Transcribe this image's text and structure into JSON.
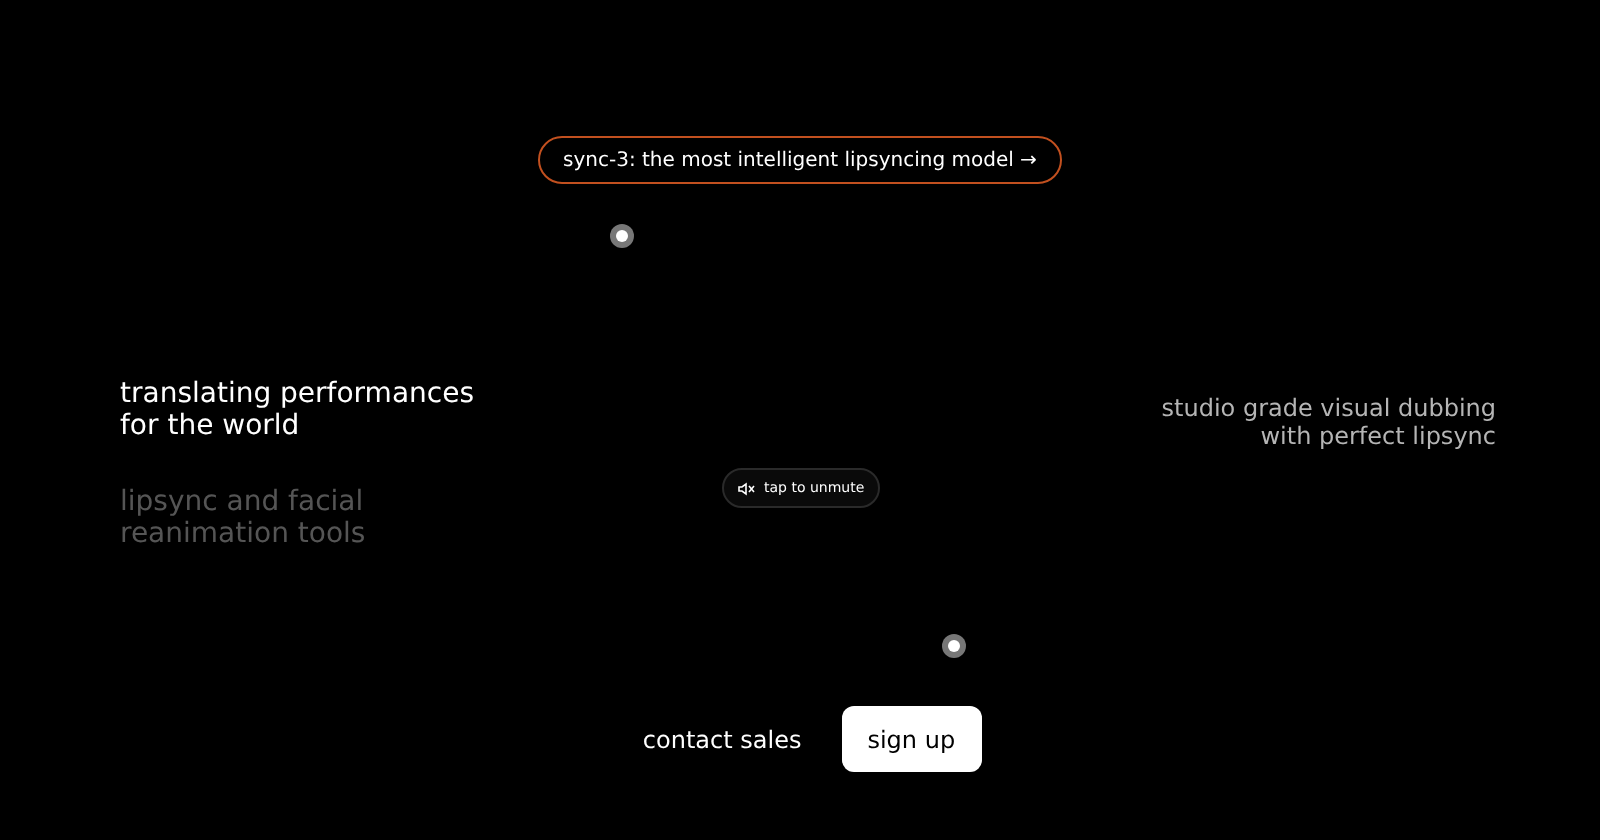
{
  "announcement": {
    "text": "sync-3: the most intelligent lipsyncing model →"
  },
  "left": {
    "headline": [
      "translating performances",
      "for the world"
    ],
    "subtitle": [
      "lipsync and facial",
      "reanimation tools"
    ]
  },
  "right": {
    "tagline": [
      "studio grade visual dubbing",
      "with perfect lipsync"
    ]
  },
  "unmute": {
    "label": "tap to unmute",
    "muted": true
  },
  "actions": [
    {
      "label": "contact sales",
      "kind": "link"
    },
    {
      "label": "sign up",
      "kind": "primary"
    }
  ]
}
